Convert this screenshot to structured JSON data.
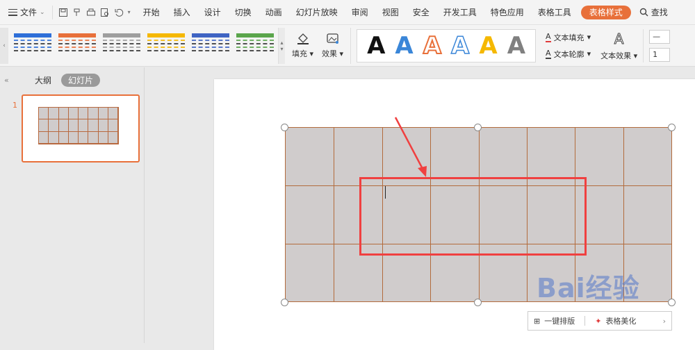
{
  "menubar": {
    "file_label": "文件",
    "tabs": [
      "开始",
      "插入",
      "设计",
      "切换",
      "动画",
      "幻灯片放映",
      "审阅",
      "视图",
      "安全",
      "开发工具",
      "特色应用",
      "表格工具",
      "表格样式"
    ],
    "active_tab": "表格样式",
    "search_label": "查找"
  },
  "ribbon": {
    "fill_label": "填充",
    "effect_label": "效果",
    "text_fill_label": "文本填充",
    "text_outline_label": "文本轮廓",
    "text_effect_label": "文本效果",
    "trail_value": "1",
    "table_style_colors": [
      "#2e6fd8",
      "#e8703a",
      "#9e9e9e",
      "#f5b800",
      "#3f64c3",
      "#5aa54b"
    ],
    "wordart_colors": [
      "#111111",
      "#3a86d8",
      "#e8703a",
      "#3a86d8",
      "#f5b800",
      "#808080"
    ]
  },
  "leftpanel": {
    "outline_tab": "大纲",
    "slides_tab": "幻灯片",
    "slide_number": "1"
  },
  "floatbar": {
    "one_click_layout": "一键排版",
    "table_beautify": "表格美化"
  },
  "watermark": {
    "text": "Bai经验"
  },
  "colors": {
    "accent": "#e8703a",
    "table_fill": "#d0cccc",
    "table_border": "#b26b3c",
    "highlight": "#f04040"
  }
}
